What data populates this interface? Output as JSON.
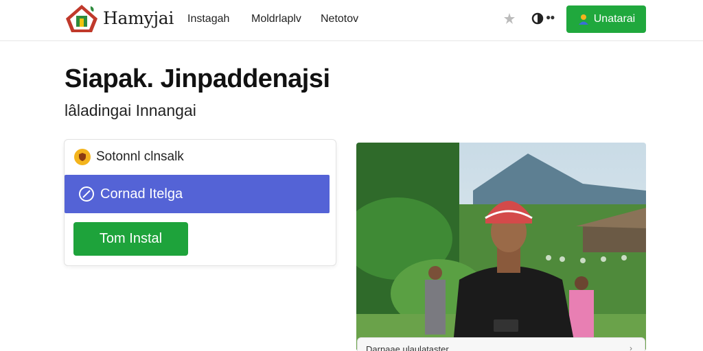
{
  "header": {
    "brand": "Hamyjai",
    "brand_tagline": "...",
    "nav": [
      "Instagah",
      "Moldrlaplv",
      "Netotov"
    ],
    "cta_label": "Unatarai",
    "icons": [
      "star-icon",
      "theme-toggle-icon",
      "more-dots-icon",
      "user-icon"
    ],
    "accent_color": "#20a83d"
  },
  "hero": {
    "title": "Siapak. Jinpaddenajsi",
    "subtitle": "lâladingai Innangai"
  },
  "card": {
    "option_label": "Sotonnl clnsalk",
    "selected_label": "Cornad Itelga",
    "install_label": "Tom Instal",
    "selected_color": "#5463d6"
  },
  "photo": {
    "caption": "Darnaae ulaulataster",
    "icon": "chevron-icon"
  }
}
